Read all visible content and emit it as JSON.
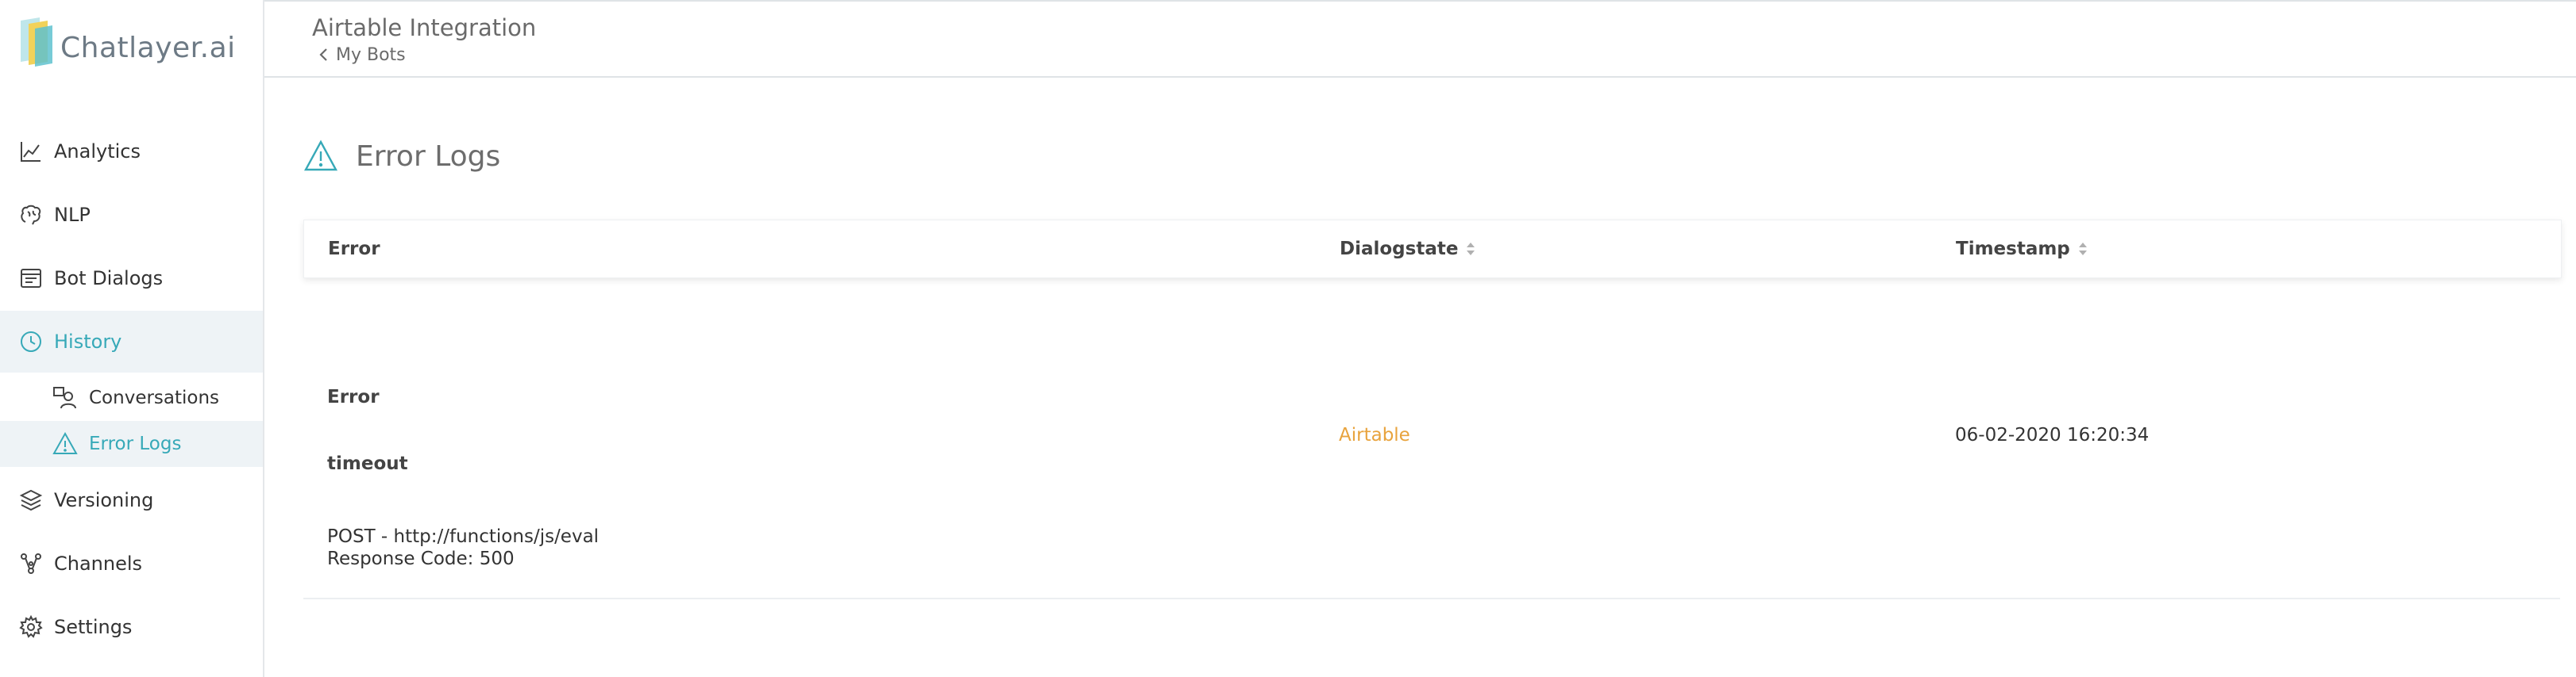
{
  "brand": {
    "name": "Chatlayer.ai"
  },
  "sidebar": {
    "items": [
      {
        "label": "Analytics"
      },
      {
        "label": "NLP"
      },
      {
        "label": "Bot Dialogs"
      },
      {
        "label": "History"
      },
      {
        "label": "Versioning"
      },
      {
        "label": "Channels"
      },
      {
        "label": "Settings"
      }
    ],
    "history_sub": [
      {
        "label": "Conversations"
      },
      {
        "label": "Error Logs"
      }
    ]
  },
  "header": {
    "title": "Airtable Integration",
    "back_label": "My Bots"
  },
  "main": {
    "page_title": "Error Logs",
    "columns": [
      "Error",
      "Dialogstate",
      "Timestamp"
    ],
    "rows": [
      {
        "error_heading": "Error",
        "error_type": "timeout",
        "request": "POST - http://functions/js/eval",
        "response": "Response Code: 500",
        "dialogstate": "Airtable",
        "timestamp": "06-02-2020 16:20:34"
      }
    ]
  },
  "colors": {
    "accent": "#37a9b8",
    "dialogstate": "#e8a33d",
    "active_bg": "#eef3f6"
  }
}
